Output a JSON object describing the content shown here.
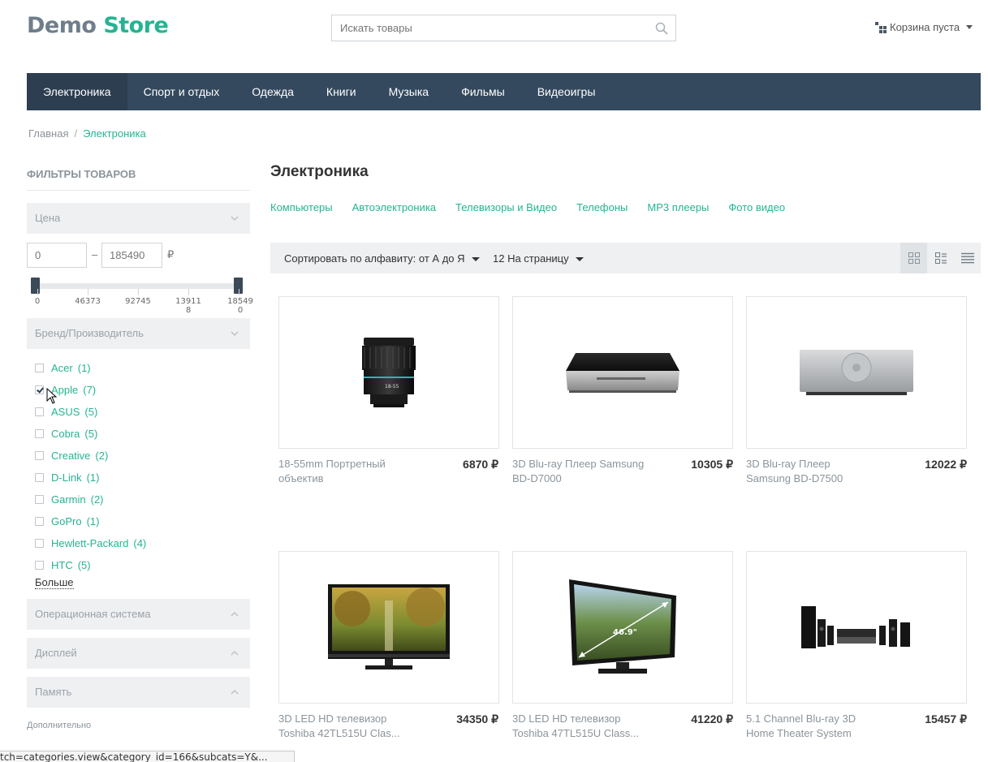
{
  "header": {
    "logo_part1": "Demo",
    "logo_part2": "Store",
    "search_placeholder": "Искать товары",
    "cart_label": "Корзина пуста"
  },
  "nav": [
    "Электроника",
    "Спорт и отдых",
    "Одежда",
    "Книги",
    "Музыка",
    "Фильмы",
    "Видеоигры"
  ],
  "breadcrumb": {
    "home": "Главная",
    "sep": "/",
    "current": "Электроника"
  },
  "sidebar": {
    "title": "ФИЛЬТРЫ ТОВАРОВ",
    "price_facet": "Цена",
    "price_min": "0",
    "price_max": "185490",
    "dash": "–",
    "currency": "₽",
    "slider_ticks": [
      "0",
      "46373",
      "92745",
      "13911\n8",
      "18549\n0"
    ],
    "brand_facet": "Бренд/Производитель",
    "brands": [
      {
        "name": "Acer",
        "count": "(1)",
        "checked": false
      },
      {
        "name": "Apple",
        "count": "(7)",
        "checked": true
      },
      {
        "name": "ASUS",
        "count": "(5)",
        "checked": false
      },
      {
        "name": "Cobra",
        "count": "(5)",
        "checked": false
      },
      {
        "name": "Creative",
        "count": "(2)",
        "checked": false
      },
      {
        "name": "D-Link",
        "count": "(1)",
        "checked": false
      },
      {
        "name": "Garmin",
        "count": "(2)",
        "checked": false
      },
      {
        "name": "GoPro",
        "count": "(1)",
        "checked": false
      },
      {
        "name": "Hewlett-Packard",
        "count": "(4)",
        "checked": false
      },
      {
        "name": "HTC",
        "count": "(5)",
        "checked": false
      }
    ],
    "more": "Больше",
    "os_facet": "Операционная система",
    "display_facet": "Дисплей",
    "memory_facet": "Память",
    "extra": "Дополнительно"
  },
  "main": {
    "title": "Электроника",
    "subcategories": [
      "Компьютеры",
      "Автоэлектроника",
      "Телевизоры и Видео",
      "Телефоны",
      "MP3 плееры",
      "Фото видео"
    ],
    "sort_label": "Сортировать по алфавиту: от А до Я",
    "per_page_label": "12 На страницу",
    "products": [
      {
        "name": "18-55mm Портретный объектив",
        "price": "6870 ₽"
      },
      {
        "name": "3D Blu-ray Плеер Samsung BD-D7000",
        "price": "10305 ₽"
      },
      {
        "name": "3D Blu-ray Плеер  Samsung BD-D7500",
        "price": "12022 ₽"
      },
      {
        "name": "3D LED HD телевизор Toshiba 42TL515U Clas...",
        "price": "34350 ₽"
      },
      {
        "name": "3D LED HD телевизор Toshiba 47TL515U Class...",
        "price": "41220 ₽"
      },
      {
        "name": "5.1 Channel Blu-ray 3D Home Theater System",
        "price": "15457 ₽"
      }
    ],
    "tv_size_label": "46.9\""
  },
  "status_bar": "tch=categories.view&category_id=166&subcats=Y&..."
}
